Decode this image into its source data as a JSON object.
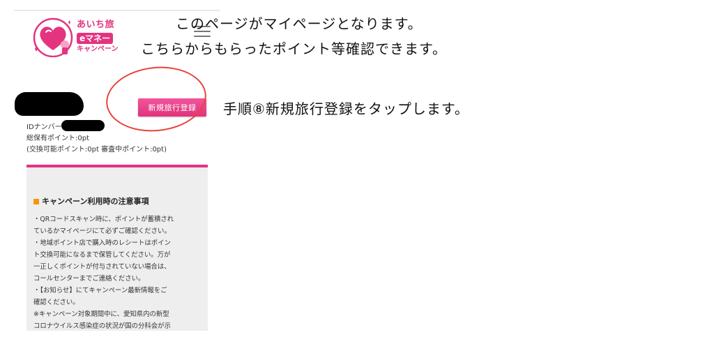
{
  "header": {
    "logo": {
      "line1": "あいち旅",
      "line2": "eマネー",
      "line3": "キャンペーン"
    },
    "menu_icon": "hamburger-menu-icon"
  },
  "account": {
    "register_button_label": "新規旅行登録",
    "id_label": "IDナンバー",
    "total_points": "総保有ポイント:0pt",
    "points_breakdown": "(交換可能ポイント:0pt 審査中ポイント:0pt)"
  },
  "notice": {
    "title": "キャンペーン利用時の注意事項",
    "lines": [
      "・QRコードスキャン時に、ポイントが蓄積され",
      "ているかマイページにて必ずご確認ください。",
      "・地域ポイント店で購入時のレシートはポイン",
      "ト交換可能になるまで保管してください。万が",
      "一正しくポイントが付与されていない場合は、",
      "コールセンターまでご連絡ください。",
      "・【お知らせ】にてキャンペーン最新情報をご",
      "確認ください。",
      "※キャンペーン対象期間中に、愛知県内の新型",
      "コロナウイルス感染症の状況が国の分科会が示"
    ]
  },
  "annotations": {
    "line1": "このページがマイページとなります。",
    "line2": "こちらからもらったポイント等確認できます。",
    "line3": "手順⑧新規旅行登録をタップします。"
  },
  "colors": {
    "brand_pink": "#e4337f",
    "accent_orange": "#f39800",
    "annotation_circle": "#e8423a"
  }
}
